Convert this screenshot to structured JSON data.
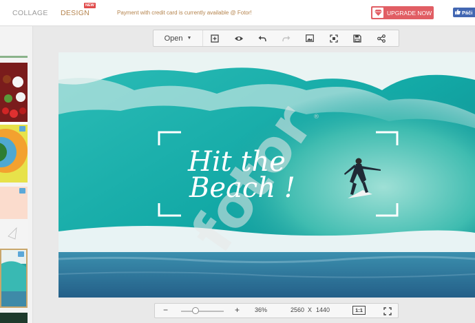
{
  "topbar": {
    "collage_label": "COLLAGE",
    "design_label": "DESIGN",
    "new_badge": "NEW",
    "notice": "Payment with credit card is currently available @ Fotor!",
    "upgrade_label": "UPGRADE NOW",
    "facebook_label": "Páči"
  },
  "toolbar": {
    "open_label": "Open",
    "icons": [
      "add-icon",
      "eye-icon",
      "undo-icon",
      "redo-icon",
      "image-icon",
      "crop-fit-icon",
      "save-icon",
      "share-icon"
    ]
  },
  "canvas": {
    "headline_line1": "Hit the",
    "headline_line2": "Beach !",
    "watermark": "fotor"
  },
  "bottombar": {
    "zoom_out": "−",
    "zoom_in": "+",
    "zoom_percent": "36%",
    "width": "2560",
    "times": "X",
    "height": "1440",
    "ratio_label": "1:1"
  },
  "colors": {
    "brand_gold": "#b4834c",
    "upgrade_red": "#e15e64",
    "facebook_blue": "#4267b2",
    "sea_teal": "#1a8c8c"
  }
}
